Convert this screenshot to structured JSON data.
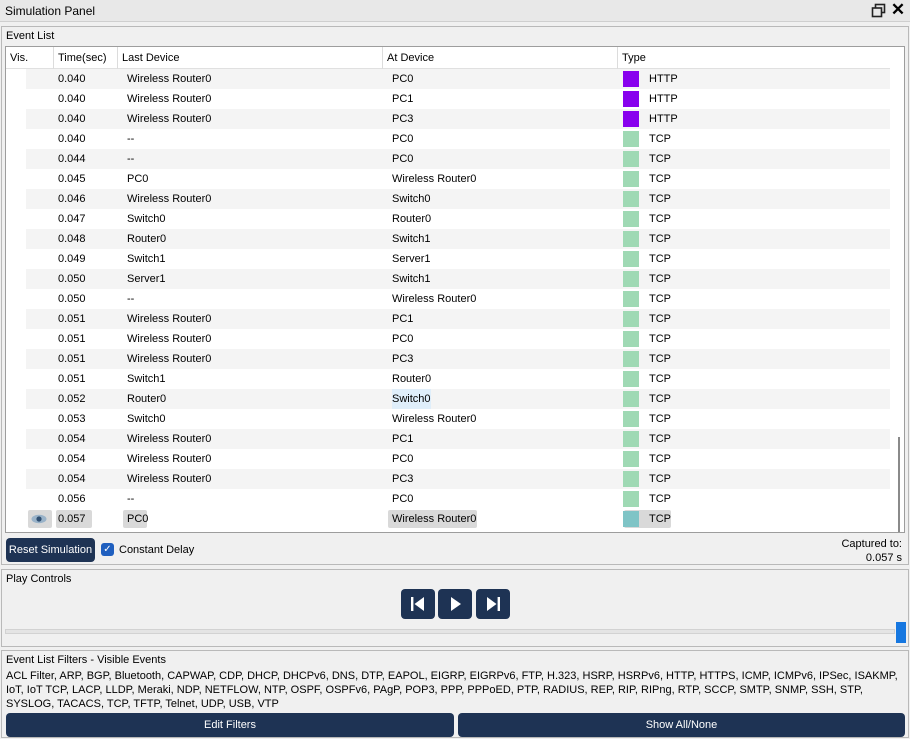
{
  "window": {
    "title": "Simulation Panel"
  },
  "event_list": {
    "label": "Event List",
    "columns": [
      "Vis.",
      "Time(sec)",
      "Last Device",
      "At Device",
      "Type"
    ],
    "rows": [
      {
        "time": "0.040",
        "last": "Wireless Router0",
        "at": "PC0",
        "type": "HTTP",
        "color": "#8800ee"
      },
      {
        "time": "0.040",
        "last": "Wireless Router0",
        "at": "PC1",
        "type": "HTTP",
        "color": "#8800ee"
      },
      {
        "time": "0.040",
        "last": "Wireless Router0",
        "at": "PC3",
        "type": "HTTP",
        "color": "#8800ee"
      },
      {
        "time": "0.040",
        "last": "--",
        "at": "PC0",
        "type": "TCP",
        "color": "#9fd9b4"
      },
      {
        "time": "0.044",
        "last": "--",
        "at": "PC0",
        "type": "TCP",
        "color": "#9fd9b4"
      },
      {
        "time": "0.045",
        "last": "PC0",
        "at": "Wireless Router0",
        "type": "TCP",
        "color": "#9fd9b4"
      },
      {
        "time": "0.046",
        "last": "Wireless Router0",
        "at": "Switch0",
        "type": "TCP",
        "color": "#9fd9b4"
      },
      {
        "time": "0.047",
        "last": "Switch0",
        "at": "Router0",
        "type": "TCP",
        "color": "#9fd9b4"
      },
      {
        "time": "0.048",
        "last": "Router0",
        "at": "Switch1",
        "type": "TCP",
        "color": "#9fd9b4"
      },
      {
        "time": "0.049",
        "last": "Switch1",
        "at": "Server1",
        "type": "TCP",
        "color": "#9fd9b4"
      },
      {
        "time": "0.050",
        "last": "Server1",
        "at": "Switch1",
        "type": "TCP",
        "color": "#9fd9b4"
      },
      {
        "time": "0.050",
        "last": "--",
        "at": "Wireless Router0",
        "type": "TCP",
        "color": "#9fd9b4"
      },
      {
        "time": "0.051",
        "last": "Wireless Router0",
        "at": "PC1",
        "type": "TCP",
        "color": "#9fd9b4"
      },
      {
        "time": "0.051",
        "last": "Wireless Router0",
        "at": "PC0",
        "type": "TCP",
        "color": "#9fd9b4"
      },
      {
        "time": "0.051",
        "last": "Wireless Router0",
        "at": "PC3",
        "type": "TCP",
        "color": "#9fd9b4"
      },
      {
        "time": "0.051",
        "last": "Switch1",
        "at": "Router0",
        "type": "TCP",
        "color": "#9fd9b4"
      },
      {
        "time": "0.052",
        "last": "Router0",
        "at": "Switch0",
        "type": "TCP",
        "color": "#9fd9b4"
      },
      {
        "time": "0.053",
        "last": "Switch0",
        "at": "Wireless Router0",
        "type": "TCP",
        "color": "#9fd9b4"
      },
      {
        "time": "0.054",
        "last": "Wireless Router0",
        "at": "PC1",
        "type": "TCP",
        "color": "#9fd9b4"
      },
      {
        "time": "0.054",
        "last": "Wireless Router0",
        "at": "PC0",
        "type": "TCP",
        "color": "#9fd9b4"
      },
      {
        "time": "0.054",
        "last": "Wireless Router0",
        "at": "PC3",
        "type": "TCP",
        "color": "#9fd9b4"
      },
      {
        "time": "0.056",
        "last": "--",
        "at": "PC0",
        "type": "TCP",
        "color": "#9fd9b4"
      },
      {
        "time": "0.057",
        "last": "PC0",
        "at": "Wireless Router0",
        "type": "TCP",
        "color": "#7fc4c6",
        "visible_icon": "eye-icon"
      }
    ],
    "reset_button": "Reset Simulation",
    "constant_delay_label": "Constant Delay",
    "captured_label": "Captured to:",
    "captured_value": "0.057 s"
  },
  "play_controls": {
    "label": "Play Controls",
    "icons": [
      "step-back-icon",
      "play-icon",
      "step-forward-icon"
    ]
  },
  "filters": {
    "label": "Event List Filters - Visible Events",
    "text": "ACL Filter, ARP, BGP, Bluetooth, CAPWAP, CDP, DHCP, DHCPv6, DNS, DTP, EAPOL, EIGRP, EIGRPv6, FTP, H.323, HSRP, HSRPv6, HTTP, HTTPS, ICMP, ICMPv6, IPSec, ISAKMP, IoT, IoT TCP, LACP, LLDP, Meraki, NDP, NETFLOW, NTP, OSPF, OSPFv6, PAgP, POP3, PPP, PPPoED, PTP, RADIUS, REP, RIP, RIPng, RTP, SCCP, SMTP, SNMP, SSH, STP, SYSLOG, TACACS, TCP, TFTP, Telnet, UDP, USB, VTP",
    "edit_button": "Edit Filters",
    "show_button": "Show All/None"
  }
}
